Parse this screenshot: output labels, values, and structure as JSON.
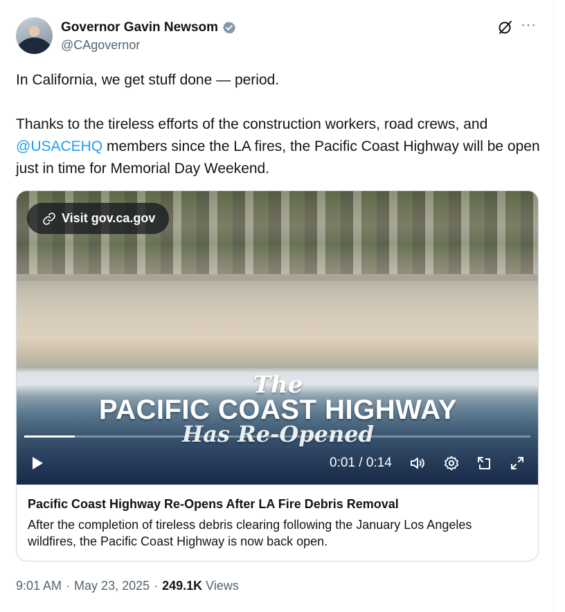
{
  "author": {
    "display_name": "Governor Gavin Newsom",
    "handle": "@CAgovernor",
    "verified_icon": "verified-badge-icon"
  },
  "tweet": {
    "line1": "In California, we get stuff done — period.",
    "line2_before": "Thanks to the tireless efforts of the construction workers, road crews, and ",
    "mention": "@USACEHQ",
    "line2_after": " members since the LA fires, the Pacific Coast Highway will be open just in time for Memorial Day Weekend."
  },
  "video": {
    "visit_label": "Visit gov.ca.gov",
    "overlay_the": "The",
    "overlay_main": "PACIFIC COAST HIGHWAY",
    "overlay_sub": "Has Re-Opened",
    "timecode": "0:01 / 0:14",
    "progress": 0.1
  },
  "card": {
    "title": "Pacific Coast Highway Re-Opens After LA Fire Debris Removal",
    "description": "After the completion of tireless debris clearing following the January Los Angeles wildfires, the Pacific Coast Highway is now back open."
  },
  "meta": {
    "time": "9:01 AM",
    "date": "May 23, 2025",
    "views_count": "249.1K",
    "views_label": "Views",
    "separator": "·"
  },
  "colors": {
    "accent": "#1d9bf0",
    "text": "#0f1419",
    "muted": "#536471",
    "border": "#cfd9de"
  }
}
